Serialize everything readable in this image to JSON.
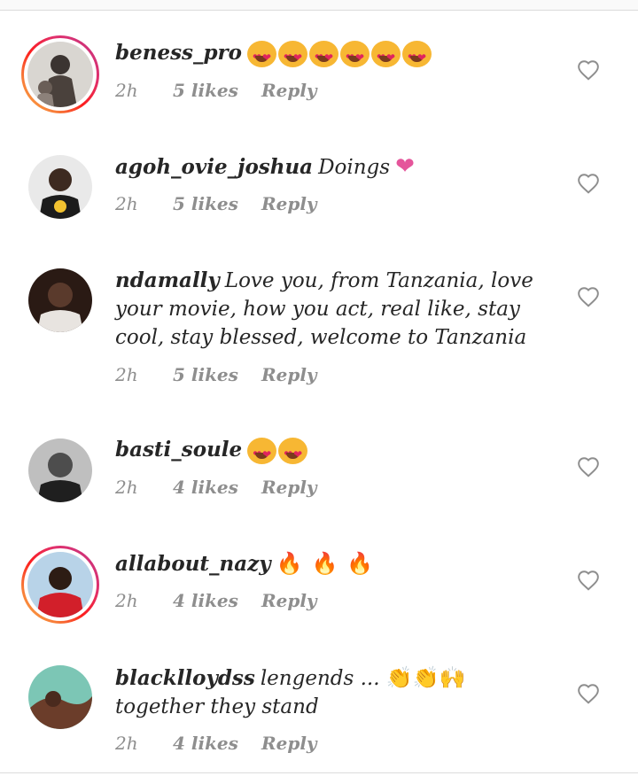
{
  "comments": [
    {
      "username": "beness_pro",
      "text": "",
      "emoji": "heart-eyes x6",
      "time": "2h",
      "likes": "5 likes",
      "reply": "Reply",
      "has_story_ring": true
    },
    {
      "username": "agoh_ovie_joshua",
      "text": "Doings",
      "emoji": "pink-heart",
      "time": "2h",
      "likes": "5 likes",
      "reply": "Reply",
      "has_story_ring": false
    },
    {
      "username": "ndamally",
      "text": "Love you, from Tanzania, love your movie, how you act, real like, stay cool, stay blessed, welcome to Tanzania",
      "time": "2h",
      "likes": "5 likes",
      "reply": "Reply",
      "has_story_ring": false
    },
    {
      "username": "basti_soule",
      "text": "",
      "emoji": "heart-eyes x2",
      "time": "2h",
      "likes": "4 likes",
      "reply": "Reply",
      "has_story_ring": false
    },
    {
      "username": "allabout_nazy",
      "text": "",
      "emoji": "fire x3",
      "time": "2h",
      "likes": "4 likes",
      "reply": "Reply",
      "has_story_ring": true
    },
    {
      "username": "blacklloydss",
      "text_before": "lengends ...",
      "text_after": "together they stand",
      "emoji": "clapping-hands x2, raising-hands",
      "time": "2h",
      "likes": "4 likes",
      "reply": "Reply",
      "has_story_ring": false
    }
  ],
  "colors": {
    "text_primary": "#262626",
    "text_secondary": "#8e8e8e",
    "story_ring_start": "#c13584",
    "story_ring_end": "#fcaf45",
    "like_icon": "#8e8e8e"
  }
}
